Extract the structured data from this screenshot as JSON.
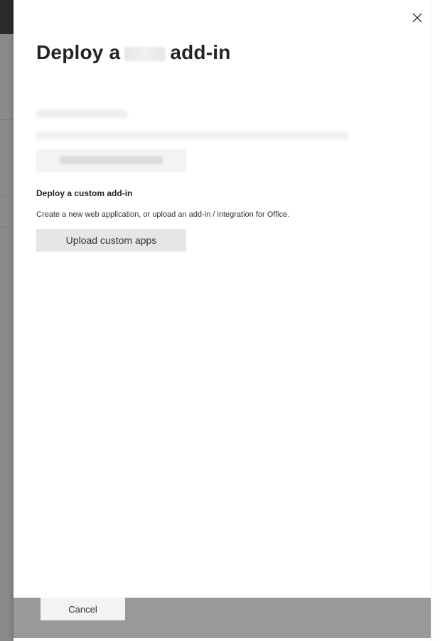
{
  "panel": {
    "title_prefix": "Deploy a",
    "title_suffix": "add-in",
    "close_icon": "close-icon"
  },
  "custom_section": {
    "heading": "Deploy a custom add-in",
    "description": "Create a new web application, or upload an add-in / integration for Office.",
    "upload_button_label": "Upload custom apps"
  },
  "footer": {
    "cancel_label": "Cancel"
  },
  "colors": {
    "title_text": "#252423",
    "button_bg": "#e6e6e6",
    "footer_overlay": "#999999"
  }
}
